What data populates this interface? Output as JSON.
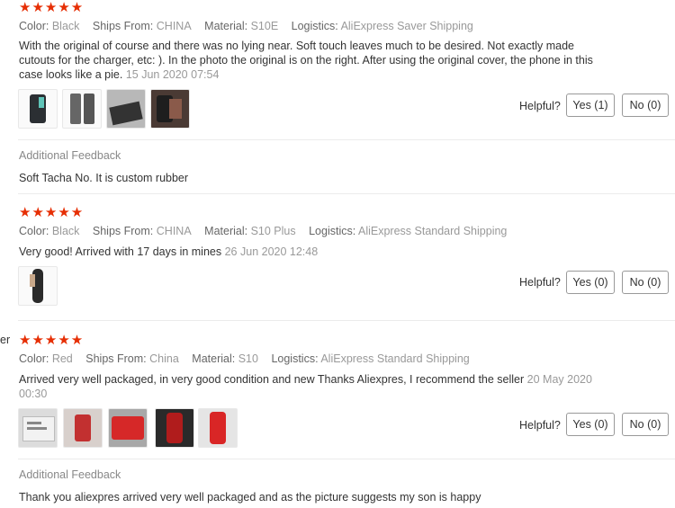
{
  "labels": {
    "color": "Color:",
    "ships_from": "Ships From:",
    "material": "Material:",
    "logistics": "Logistics:",
    "helpful": "Helpful?",
    "additional_feedback": "Additional Feedback"
  },
  "stars": "★★★★★",
  "reviews": [
    {
      "rating": 5,
      "color": "Black",
      "ships_from": "CHINA",
      "material": "S10E",
      "logistics": "AliExpress Saver Shipping",
      "text": "With the original of course and there was no lying near. Soft touch leaves much to be desired. Not exactly made cutouts for the charger, etc: ). In the photo the original is on the right. After using the original cover, the phone in this case looks like a pie.",
      "date": "15 Jun 2020 07:54",
      "yes": "Yes (1)",
      "no": "No (0)",
      "additional_feedback": "Soft Tacha No. It is custom rubber"
    },
    {
      "rating": 5,
      "color": "Black",
      "ships_from": "CHINA",
      "material": "S10 Plus",
      "logistics": "AliExpress Standard Shipping",
      "text": "Very good! Arrived with 17 days in mines",
      "date": "26 Jun 2020 12:48",
      "yes": "Yes (0)",
      "no": "No (0)"
    },
    {
      "rating": 5,
      "cut_label": "er",
      "color": "Red",
      "ships_from": "China",
      "material": "S10",
      "logistics": "AliExpress Standard Shipping",
      "text": "Arrived very well packaged, in very good condition and new Thanks Aliexpres, I recommend the seller",
      "date": "20 May 2020 00:30",
      "yes": "Yes (0)",
      "no": "No (0)",
      "additional_feedback": "Thank you aliexpres arrived very well packaged and as the picture suggests my son is happy"
    }
  ]
}
